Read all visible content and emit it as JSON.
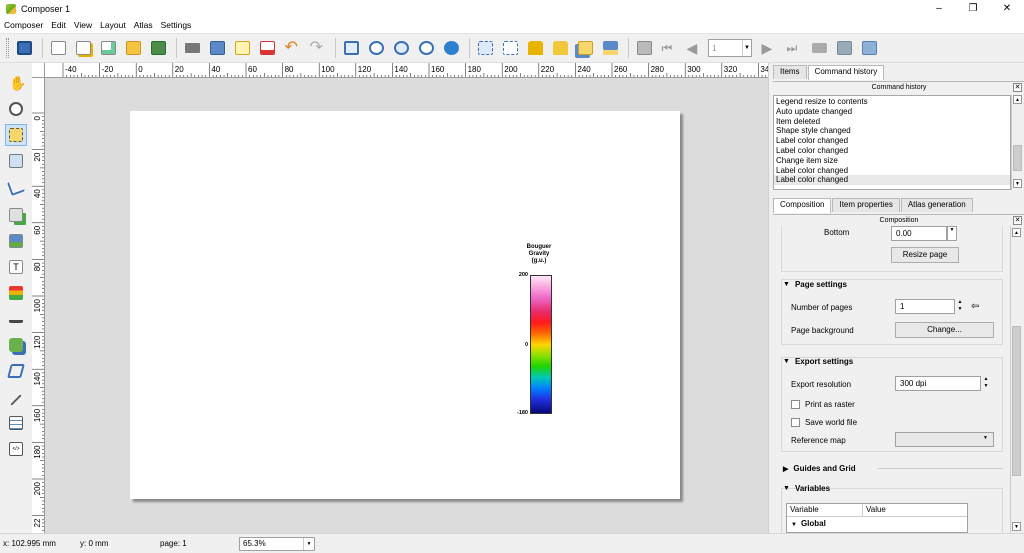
{
  "window": {
    "title": "Composer 1",
    "controls": [
      "–",
      "❐",
      "✕"
    ]
  },
  "menu": [
    "Composer",
    "Edit",
    "View",
    "Layout",
    "Atlas",
    "Settings"
  ],
  "toolbar": {
    "icons": [
      "save-project-icon",
      "new-composer-icon",
      "duplicate-composer-icon",
      "composer-manager-icon",
      "load-template-icon",
      "save-template-icon",
      "print-icon",
      "export-image-icon",
      "export-svg-icon",
      "export-pdf-icon",
      "undo-icon",
      "redo-icon",
      "zoom-full-icon",
      "zoom-actual-icon",
      "zoom-in-icon",
      "zoom-out-icon",
      "refresh-icon",
      "group-items-icon",
      "ungroup-icon",
      "lock-items-icon",
      "unlock-items-icon",
      "raise-items-icon",
      "align-items-icon",
      "atlas-preview-icon",
      "first-feature-icon",
      "previous-feature-icon",
      "next-feature-icon",
      "last-feature-icon",
      "atlas-print-icon",
      "atlas-export-icon",
      "atlas-settings-icon"
    ],
    "atlas_page_value": "1"
  },
  "left_tools": [
    "pan-icon",
    "zoom-tool-icon",
    "select-move-icon",
    "move-content-icon",
    "edit-nodes-icon",
    "add-map-icon",
    "add-image-icon",
    "add-label-icon",
    "add-legend-icon",
    "add-scalebar-icon",
    "add-shape-icon",
    "add-arrow-icon",
    "add-polyline-icon",
    "add-attribute-table-icon",
    "add-html-icon"
  ],
  "hruler_labels": [
    "-40",
    "-20",
    "0",
    "20",
    "40",
    "60",
    "80",
    "100",
    "120",
    "140",
    "160",
    "180",
    "200",
    "220",
    "240",
    "260",
    "280",
    "300",
    "320",
    "34"
  ],
  "vruler_labels": [
    "0",
    "20",
    "40",
    "60",
    "80",
    "100",
    "120",
    "140",
    "160",
    "180",
    "200",
    "22"
  ],
  "legend": {
    "title_lines": [
      "Bouguer",
      "Gravity",
      "(g.u.)"
    ],
    "tick_labels": [
      "200",
      "0",
      "-180"
    ]
  },
  "right_panel": {
    "top_tabs": [
      "Items",
      "Command history"
    ],
    "top_active_tab": "Command history",
    "history_header": "Command history",
    "history_items": [
      "Legend resize to contents",
      "Auto update changed",
      "Item deleted",
      "Shape style changed",
      "Label color changed",
      "Label color changed",
      "Change item size",
      "Label color changed",
      "Label color changed"
    ],
    "bottom_tabs": [
      "Composition",
      "Item properties",
      "Atlas generation"
    ],
    "composition_header": "Composition",
    "bottom_label": "Bottom",
    "bottom_value": "0.00",
    "resize_page_button": "Resize page",
    "page_settings_title": "Page settings",
    "number_of_pages_label": "Number of pages",
    "number_of_pages_value": "1",
    "page_background_label": "Page background",
    "change_button": "Change...",
    "export_settings_title": "Export settings",
    "export_resolution_label": "Export resolution",
    "export_resolution_value": "300 dpi",
    "print_as_raster_label": "Print as raster",
    "print_as_raster_checked": false,
    "save_world_file_label": "Save world file",
    "save_world_file_checked": false,
    "reference_map_label": "Reference map",
    "reference_map_value": "",
    "guides_grid_title": "Guides and Grid",
    "variables_title": "Variables",
    "variables_columns": [
      "Variable",
      "Value"
    ],
    "variables_group": "Global"
  },
  "status": {
    "x": "x: 102.995 mm",
    "y": "y: 0 mm",
    "page": "page: 1",
    "zoom": "65.3%"
  }
}
